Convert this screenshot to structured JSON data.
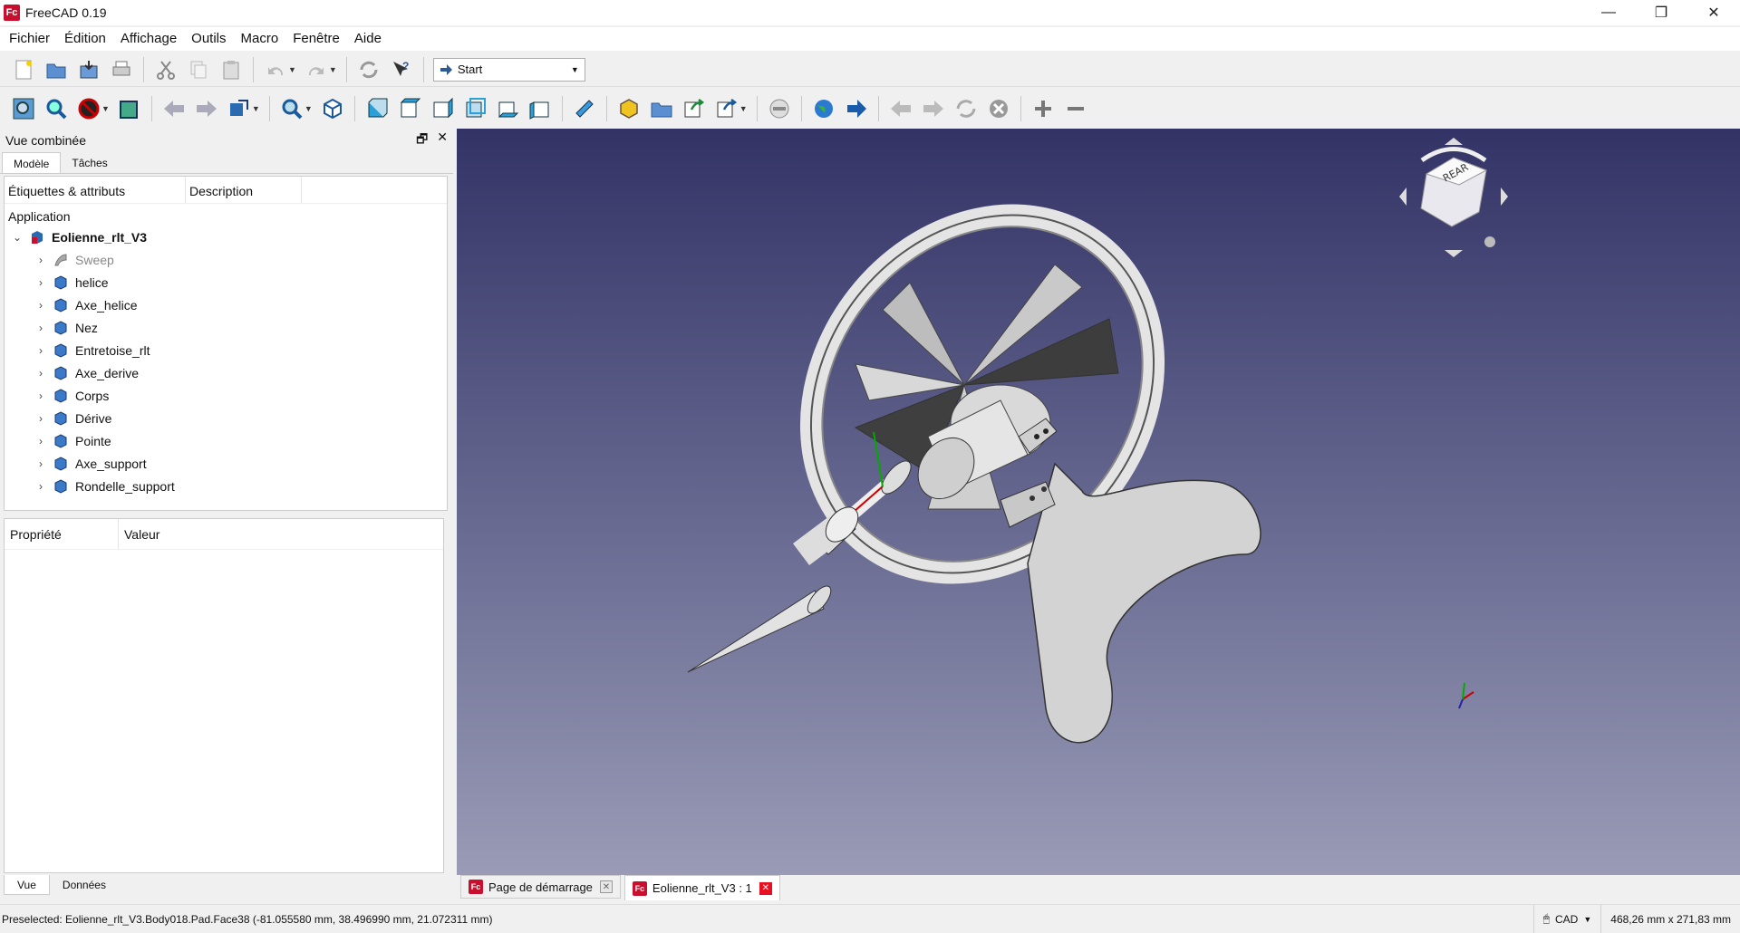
{
  "window": {
    "title": "FreeCAD 0.19",
    "logo_text": "Fc",
    "minimize": "—",
    "restore": "❐",
    "close": "✕"
  },
  "menu": [
    "Fichier",
    "Édition",
    "Affichage",
    "Outils",
    "Macro",
    "Fenêtre",
    "Aide"
  ],
  "workbench": {
    "selected": "Start"
  },
  "combo": {
    "title": "Vue combinée",
    "tabs": [
      "Modèle",
      "Tâches"
    ],
    "tree_headers": [
      "Étiquettes & attributs",
      "Description"
    ],
    "app_label": "Application",
    "root": "Eolienne_rlt_V3",
    "items": [
      "Sweep",
      "helice",
      "Axe_helice",
      "Nez",
      "Entretoise_rlt",
      "Axe_derive",
      "Corps",
      "Dérive",
      "Pointe",
      "Axe_support",
      "Rondelle_support"
    ],
    "prop_headers": [
      "Propriété",
      "Valeur"
    ],
    "bottom_tabs": [
      "Vue",
      "Données"
    ]
  },
  "doc_tabs": [
    "Page de démarrage",
    "Eolienne_rlt_V3 : 1"
  ],
  "status": {
    "preselected": "Preselected: Eolienne_rlt_V3.Body018.Pad.Face38 (-81.055580 mm, 38.496990 mm, 21.072311 mm)",
    "nav_style": "CAD",
    "dimensions": "468,26 mm x 271,83 mm"
  },
  "colors": {
    "view_top": "#333366",
    "view_bottom": "#9a9bb6",
    "accent": "#c8102e"
  }
}
